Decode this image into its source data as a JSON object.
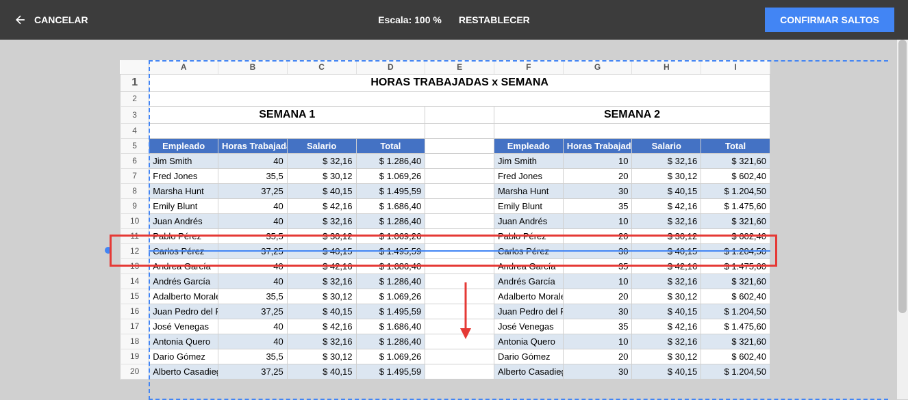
{
  "toolbar": {
    "cancel": "CANCELAR",
    "scale_label": "Escala: 100 %",
    "reset": "RESTABLECER",
    "confirm": "CONFIRMAR SALTOS"
  },
  "columns": [
    "A",
    "B",
    "C",
    "D",
    "E",
    "F",
    "G",
    "H",
    "I"
  ],
  "row_numbers": [
    "1",
    "2",
    "3",
    "4",
    "5",
    "6",
    "7",
    "8",
    "9",
    "10",
    "11",
    "12",
    "13",
    "14",
    "15",
    "16",
    "17",
    "18",
    "19",
    "20"
  ],
  "title": "HORAS TRABAJADAS x SEMANA",
  "semana1": "SEMANA 1",
  "semana2": "SEMANA 2",
  "headers": {
    "empleado": "Empleado",
    "horas": "Horas Trabajadas",
    "salario": "Salario",
    "total": "Total"
  },
  "chart_data": {
    "type": "table",
    "title": "HORAS TRABAJADAS x SEMANA",
    "sections": [
      {
        "name": "SEMANA 1",
        "columns": [
          "Empleado",
          "Horas Trabajadas",
          "Salario",
          "Total"
        ]
      },
      {
        "name": "SEMANA 2",
        "columns": [
          "Empleado",
          "Horas Trabajadas",
          "Salario",
          "Total"
        ]
      }
    ],
    "rows": [
      {
        "s1": {
          "emp": "Jim Smith",
          "h": "40",
          "sal": "$ 32,16",
          "tot": "$ 1.286,40"
        },
        "s2": {
          "emp": "Jim Smith",
          "h": "10",
          "sal": "$ 32,16",
          "tot": "$ 321,60"
        }
      },
      {
        "s1": {
          "emp": "Fred Jones",
          "h": "35,5",
          "sal": "$ 30,12",
          "tot": "$ 1.069,26"
        },
        "s2": {
          "emp": "Fred Jones",
          "h": "20",
          "sal": "$ 30,12",
          "tot": "$ 602,40"
        }
      },
      {
        "s1": {
          "emp": "Marsha Hunt",
          "h": "37,25",
          "sal": "$ 40,15",
          "tot": "$ 1.495,59"
        },
        "s2": {
          "emp": "Marsha Hunt",
          "h": "30",
          "sal": "$ 40,15",
          "tot": "$ 1.204,50"
        }
      },
      {
        "s1": {
          "emp": "Emily Blunt",
          "h": "40",
          "sal": "$ 42,16",
          "tot": "$ 1.686,40"
        },
        "s2": {
          "emp": "Emily Blunt",
          "h": "35",
          "sal": "$ 42,16",
          "tot": "$ 1.475,60"
        }
      },
      {
        "s1": {
          "emp": "Juan Andrés",
          "h": "40",
          "sal": "$ 32,16",
          "tot": "$ 1.286,40"
        },
        "s2": {
          "emp": "Juan Andrés",
          "h": "10",
          "sal": "$ 32,16",
          "tot": "$ 321,60"
        }
      },
      {
        "s1": {
          "emp": "Pablo Pérez",
          "h": "35,5",
          "sal": "$ 30,12",
          "tot": "$ 1.069,26"
        },
        "s2": {
          "emp": "Pablo Pérez",
          "h": "20",
          "sal": "$ 30,12",
          "tot": "$ 602,40"
        }
      },
      {
        "s1": {
          "emp": "Carlos Pérez",
          "h": "37,25",
          "sal": "$ 40,15",
          "tot": "$ 1.495,59"
        },
        "s2": {
          "emp": "Carlos Pérez",
          "h": "30",
          "sal": "$ 40,15",
          "tot": "$ 1.204,50"
        }
      },
      {
        "s1": {
          "emp": "Andrea García",
          "h": "40",
          "sal": "$ 42,16",
          "tot": "$ 1.686,40"
        },
        "s2": {
          "emp": "Andrea García",
          "h": "35",
          "sal": "$ 42,16",
          "tot": "$ 1.475,60"
        }
      },
      {
        "s1": {
          "emp": "Andrés García",
          "h": "40",
          "sal": "$ 32,16",
          "tot": "$ 1.286,40"
        },
        "s2": {
          "emp": "Andrés García",
          "h": "10",
          "sal": "$ 32,16",
          "tot": "$ 321,60"
        }
      },
      {
        "s1": {
          "emp": "Adalberto Morales",
          "h": "35,5",
          "sal": "$ 30,12",
          "tot": "$ 1.069,26"
        },
        "s2": {
          "emp": "Adalberto Morales",
          "h": "20",
          "sal": "$ 30,12",
          "tot": "$ 602,40"
        }
      },
      {
        "s1": {
          "emp": "Juan Pedro del Rosario",
          "h": "37,25",
          "sal": "$ 40,15",
          "tot": "$ 1.495,59"
        },
        "s2": {
          "emp": "Juan Pedro del Rosario",
          "h": "30",
          "sal": "$ 40,15",
          "tot": "$ 1.204,50"
        }
      },
      {
        "s1": {
          "emp": "José Venegas",
          "h": "40",
          "sal": "$ 42,16",
          "tot": "$ 1.686,40"
        },
        "s2": {
          "emp": "José Venegas",
          "h": "35",
          "sal": "$ 42,16",
          "tot": "$ 1.475,60"
        }
      },
      {
        "s1": {
          "emp": "Antonia Quero",
          "h": "40",
          "sal": "$ 32,16",
          "tot": "$ 1.286,40"
        },
        "s2": {
          "emp": "Antonia Quero",
          "h": "10",
          "sal": "$ 32,16",
          "tot": "$ 321,60"
        }
      },
      {
        "s1": {
          "emp": "Dario Gómez",
          "h": "35,5",
          "sal": "$ 30,12",
          "tot": "$ 1.069,26"
        },
        "s2": {
          "emp": "Dario Gómez",
          "h": "20",
          "sal": "$ 30,12",
          "tot": "$ 602,40"
        }
      },
      {
        "s1": {
          "emp": "Alberto Casadiego",
          "h": "37,25",
          "sal": "$ 40,15",
          "tot": "$ 1.495,59"
        },
        "s2": {
          "emp": "Alberto Casadiego",
          "h": "30",
          "sal": "$ 40,15",
          "tot": "$ 1.204,50"
        }
      }
    ]
  }
}
